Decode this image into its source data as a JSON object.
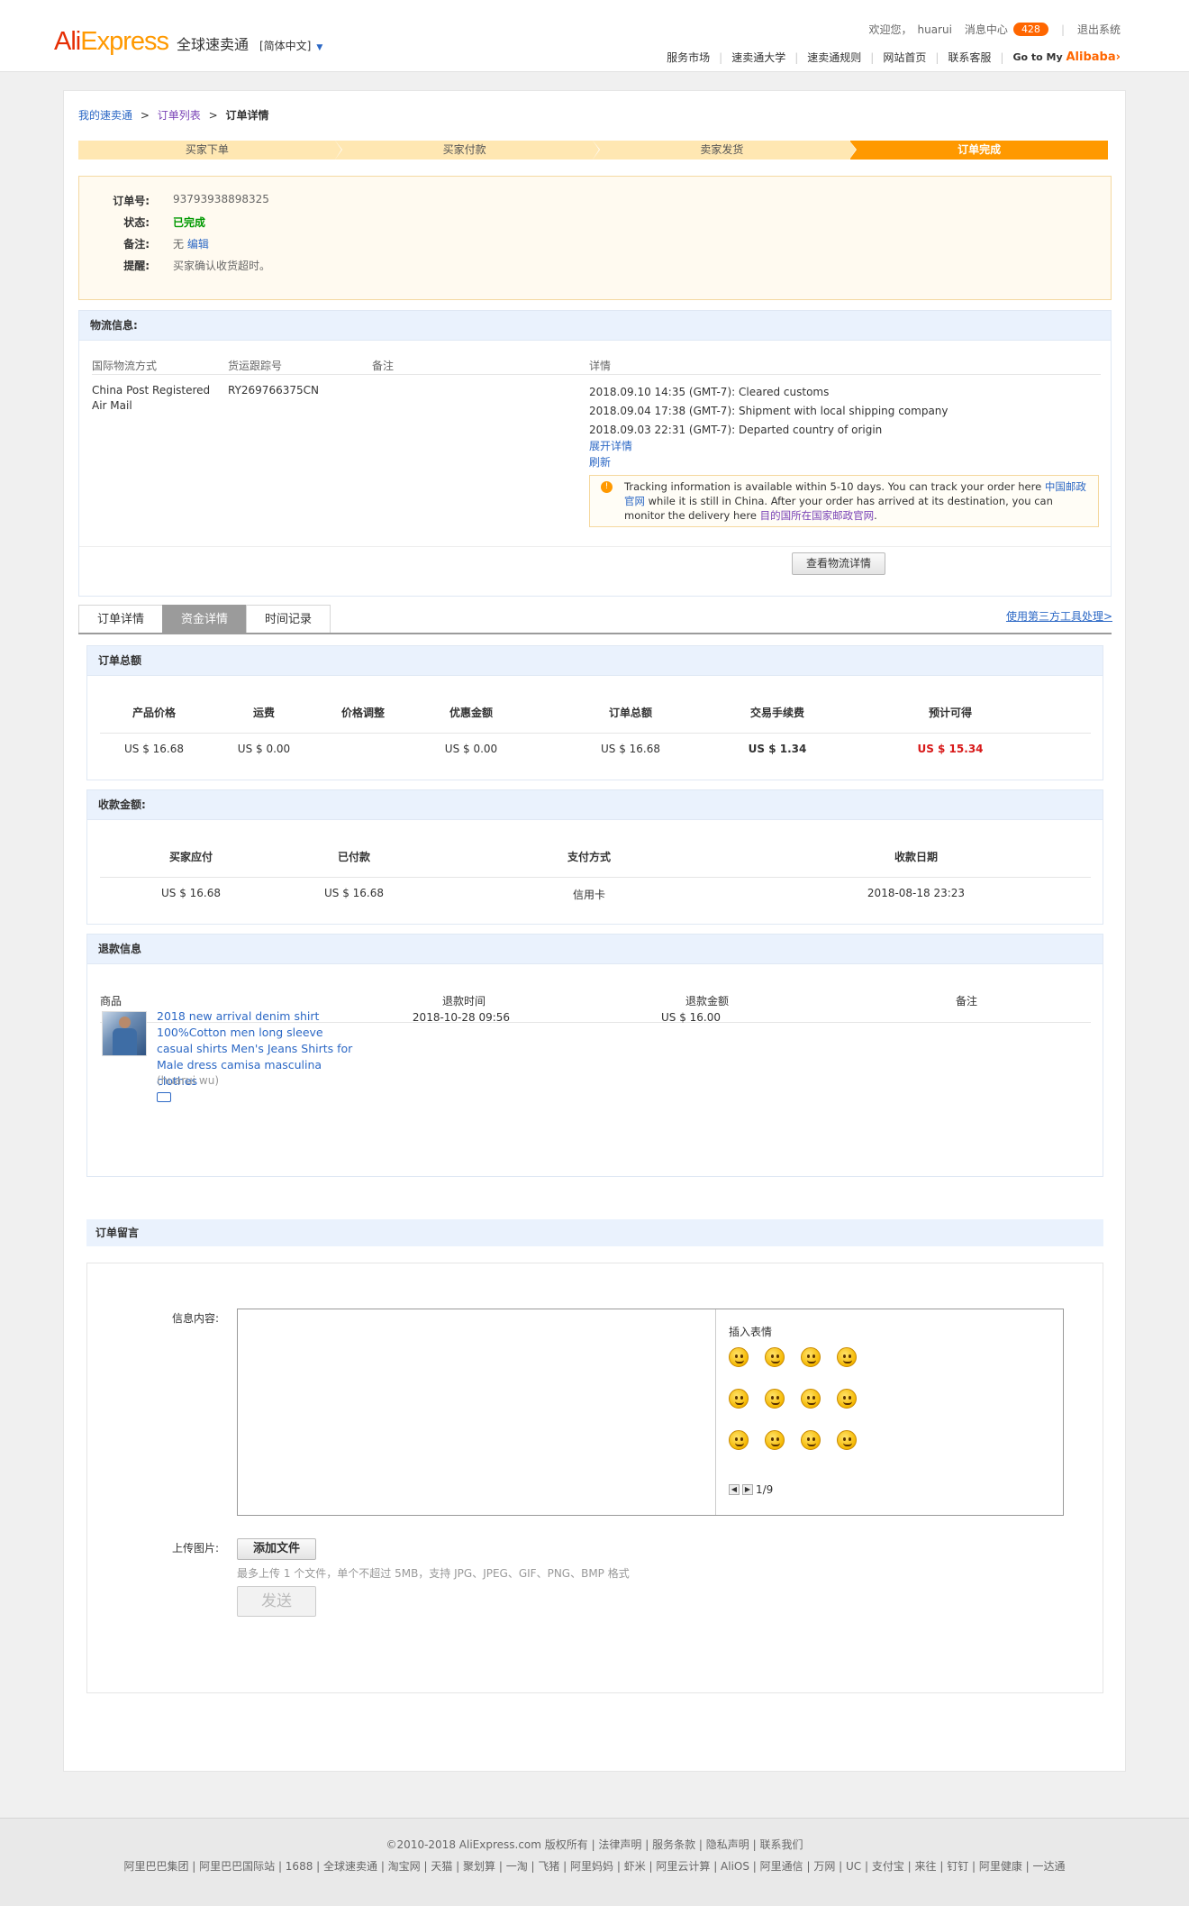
{
  "header": {
    "logo_ali": "Ali",
    "logo_express": "Express",
    "logo_cn": "全球速卖通",
    "lang": "[简体中文]",
    "welcome": "欢迎您，",
    "username": "huarui",
    "msg_center": "消息中心",
    "msg_count": "428",
    "logout": "退出系统",
    "nav": [
      "服务市场",
      "速卖通大学",
      "速卖通规则",
      "网站首页",
      "联系客服"
    ],
    "goto_prefix": "Go to My",
    "goto_brand": "Alibaba",
    "goto_arrow": "›"
  },
  "breadcrumb": {
    "items": [
      "我的速卖通",
      "订单列表",
      "订单详情"
    ],
    "sep": ">"
  },
  "steps": [
    "买家下单",
    "买家付款",
    "卖家发货",
    "订单完成"
  ],
  "order_info": {
    "rows": [
      {
        "label": "订单号:",
        "value": "93793938898325"
      },
      {
        "label": "状态:",
        "value": "已完成"
      },
      {
        "label": "备注:",
        "value": "无",
        "link": "编辑"
      },
      {
        "label": "提醒:",
        "value": "买家确认收货超时。"
      }
    ]
  },
  "logistics": {
    "title": "物流信息:",
    "headers": [
      "国际物流方式",
      "货运跟踪号",
      "备注",
      "详情"
    ],
    "method": "China Post Registered Air Mail",
    "tracking_no": "RY269766375CN",
    "events": [
      "2018.09.10 14:35 (GMT-7): Cleared customs",
      "2018.09.04 17:38 (GMT-7): Shipment with local shipping company",
      "2018.09.03 22:31 (GMT-7): Departed country of origin"
    ],
    "expand": "展开详情",
    "refresh": "刷新",
    "tip_1": "Tracking information is available within 5-10 days. You can track your order here ",
    "tip_link1": "中国邮政官网",
    "tip_2": " while it is still in China. After your order has arrived at its destination, you can monitor the delivery here ",
    "tip_link2": "目的国所在国家邮政官网",
    "tip_3": ".",
    "view_btn": "查看物流详情"
  },
  "tabs": [
    "订单详情",
    "资金详情",
    "时间记录"
  ],
  "third_party": "使用第三方工具处理>",
  "order_total": {
    "title": "订单总额",
    "headers": [
      "产品价格",
      "运费",
      "价格调整",
      "优惠金额",
      "订单总额",
      "交易手续费",
      "预计可得"
    ],
    "values": [
      "US $ 16.68",
      "US $ 0.00",
      "",
      "US $ 0.00",
      "US $ 16.68",
      "US $ 1.34",
      "US $ 15.34"
    ]
  },
  "payment": {
    "title": "收款金额:",
    "headers": [
      "买家应付",
      "已付款",
      "支付方式",
      "收款日期"
    ],
    "values": [
      "US $ 16.68",
      "US $ 16.68",
      "信用卡",
      "2018-08-18 23:23"
    ]
  },
  "refund": {
    "title": "退款信息",
    "headers": [
      "商品",
      "退款时间",
      "退款金额",
      "备注"
    ],
    "product_title": "2018 new arrival denim shirt 100%Cotton men long sleeve casual shirts Men's Jeans Shirts for Male dress camisa masculina clothes",
    "seller": "(huarui wu)",
    "time": "2018-10-28 09:56",
    "amount": "US $ 16.00"
  },
  "message": {
    "title": "订单留言",
    "content_label": "信息内容:",
    "emoji_title": "插入表情",
    "emojis": [
      "smile-emoji",
      "wink-emoji",
      "tongue-emoji",
      "giggle-emoji",
      "laugh-emoji",
      "grin-emoji",
      "cry-laugh-emoji",
      "shy-emoji",
      "hug-emoji",
      "dizzy-emoji",
      "cover-mouth-emoji",
      "cheeky-emoji"
    ],
    "page": "1/9",
    "upload_label": "上传图片:",
    "add_file": "添加文件",
    "upload_hint": "最多上传 1 个文件，单个不超过 5MB，支持 JPG、JPEG、GIF、PNG、BMP 格式",
    "send": "发送"
  },
  "footer": {
    "line1": "©2010-2018 AliExpress.com 版权所有 | 法律声明 | 服务条款 | 隐私声明 | 联系我们",
    "line2": "阿里巴巴集团 | 阿里巴巴国际站 | 1688 | 全球速卖通 | 淘宝网 | 天猫 | 聚划算 | 一淘 | 飞猪 | 阿里妈妈 | 虾米 | 阿里云计算 | AliOS | 阿里通信 | 万网 | UC | 支付宝 | 来往 | 钉钉 | 阿里健康 | 一达通"
  },
  "colors": {
    "brand_red": "#e62e04",
    "brand_orange": "#ff9900",
    "link": "#2c68c5",
    "accent_red": "#d81919"
  }
}
